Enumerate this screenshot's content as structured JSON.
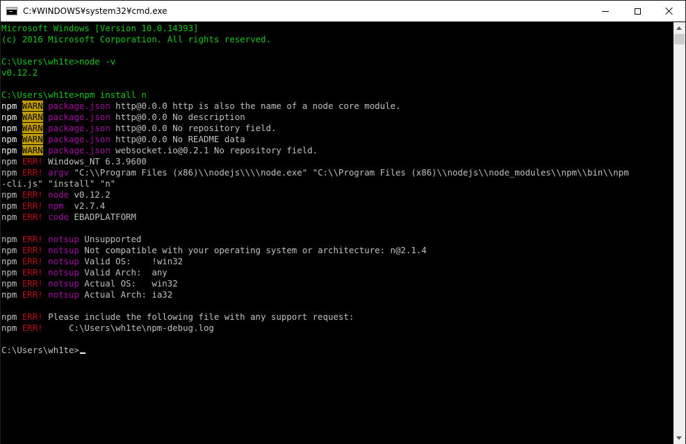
{
  "window": {
    "title": "C:¥WINDOWS¥system32¥cmd.exe",
    "controls": [
      "minimize",
      "maximize",
      "close"
    ]
  },
  "colors": {
    "console_bg": "#000000",
    "green": "#13C713",
    "white": "#F2F2F2",
    "gray": "#C0C0C0",
    "magenta": "#A10EA1",
    "red": "#B40F0F",
    "warn_highlight": "#C19C00"
  },
  "terminal": {
    "lines": [
      [
        {
          "t": "Microsoft Windows [Version 10.0.14393]",
          "c": "green"
        }
      ],
      [
        {
          "t": "(c) 2016 Microsoft Corporation. All rights reserved.",
          "c": "green"
        }
      ],
      [],
      [
        {
          "t": "C:\\Users\\wh1te>node -v",
          "c": "green"
        }
      ],
      [
        {
          "t": "v0.12.2",
          "c": "green"
        }
      ],
      [],
      [
        {
          "t": "C:\\Users\\wh1te>npm install n",
          "c": "green"
        }
      ],
      [
        {
          "t": "npm",
          "c": "white"
        },
        {
          "t": " "
        },
        {
          "t": "WARN",
          "c": "warn-bg"
        },
        {
          "t": " "
        },
        {
          "t": "package.json",
          "c": "magenta"
        },
        {
          "t": " http@0.0.0 http is also the name of a node core module."
        }
      ],
      [
        {
          "t": "npm",
          "c": "white"
        },
        {
          "t": " "
        },
        {
          "t": "WARN",
          "c": "warn-bg"
        },
        {
          "t": " "
        },
        {
          "t": "package.json",
          "c": "magenta"
        },
        {
          "t": " http@0.0.0 No description"
        }
      ],
      [
        {
          "t": "npm",
          "c": "white"
        },
        {
          "t": " "
        },
        {
          "t": "WARN",
          "c": "warn-bg"
        },
        {
          "t": " "
        },
        {
          "t": "package.json",
          "c": "magenta"
        },
        {
          "t": " http@0.0.0 No repository field."
        }
      ],
      [
        {
          "t": "npm",
          "c": "white"
        },
        {
          "t": " "
        },
        {
          "t": "WARN",
          "c": "warn-bg"
        },
        {
          "t": " "
        },
        {
          "t": "package.json",
          "c": "magenta"
        },
        {
          "t": " http@0.0.0 No README data"
        }
      ],
      [
        {
          "t": "npm",
          "c": "white"
        },
        {
          "t": " "
        },
        {
          "t": "WARN",
          "c": "warn-bg"
        },
        {
          "t": " "
        },
        {
          "t": "package.json",
          "c": "magenta"
        },
        {
          "t": " websocket.io@0.2.1 No repository field."
        }
      ],
      [
        {
          "t": "npm "
        },
        {
          "t": "ERR!",
          "c": "red"
        },
        {
          "t": " Windows_NT 6.3.9600"
        }
      ],
      [
        {
          "t": "npm "
        },
        {
          "t": "ERR!",
          "c": "red"
        },
        {
          "t": " "
        },
        {
          "t": "argv",
          "c": "magenta"
        },
        {
          "t": " \"C:\\\\Program Files (x86)\\\\nodejs\\\\\\\\node.exe\" \"C:\\\\Program Files (x86)\\\\nodejs\\\\node_modules\\\\npm\\\\bin\\\\npm"
        }
      ],
      [
        {
          "t": "-cli.js\" \"install\" \"n\""
        }
      ],
      [
        {
          "t": "npm "
        },
        {
          "t": "ERR!",
          "c": "red"
        },
        {
          "t": " "
        },
        {
          "t": "node",
          "c": "magenta"
        },
        {
          "t": " v0.12.2"
        }
      ],
      [
        {
          "t": "npm "
        },
        {
          "t": "ERR!",
          "c": "red"
        },
        {
          "t": " "
        },
        {
          "t": "npm",
          "c": "magenta"
        },
        {
          "t": "  v2.7.4"
        }
      ],
      [
        {
          "t": "npm "
        },
        {
          "t": "ERR!",
          "c": "red"
        },
        {
          "t": " "
        },
        {
          "t": "code",
          "c": "magenta"
        },
        {
          "t": " EBADPLATFORM"
        }
      ],
      [],
      [
        {
          "t": "npm "
        },
        {
          "t": "ERR!",
          "c": "red"
        },
        {
          "t": " "
        },
        {
          "t": "notsup",
          "c": "magenta"
        },
        {
          "t": " Unsupported"
        }
      ],
      [
        {
          "t": "npm "
        },
        {
          "t": "ERR!",
          "c": "red"
        },
        {
          "t": " "
        },
        {
          "t": "notsup",
          "c": "magenta"
        },
        {
          "t": " Not compatible with your operating system or architecture: n@2.1.4"
        }
      ],
      [
        {
          "t": "npm "
        },
        {
          "t": "ERR!",
          "c": "red"
        },
        {
          "t": " "
        },
        {
          "t": "notsup",
          "c": "magenta"
        },
        {
          "t": " Valid OS:    !win32"
        }
      ],
      [
        {
          "t": "npm "
        },
        {
          "t": "ERR!",
          "c": "red"
        },
        {
          "t": " "
        },
        {
          "t": "notsup",
          "c": "magenta"
        },
        {
          "t": " Valid Arch:  any"
        }
      ],
      [
        {
          "t": "npm "
        },
        {
          "t": "ERR!",
          "c": "red"
        },
        {
          "t": " "
        },
        {
          "t": "notsup",
          "c": "magenta"
        },
        {
          "t": " Actual OS:   win32"
        }
      ],
      [
        {
          "t": "npm "
        },
        {
          "t": "ERR!",
          "c": "red"
        },
        {
          "t": " "
        },
        {
          "t": "notsup",
          "c": "magenta"
        },
        {
          "t": " Actual Arch: ia32"
        }
      ],
      [],
      [
        {
          "t": "npm "
        },
        {
          "t": "ERR!",
          "c": "red"
        },
        {
          "t": " Please include the following file with any support request:"
        }
      ],
      [
        {
          "t": "npm "
        },
        {
          "t": "ERR!",
          "c": "red"
        },
        {
          "t": "     C:\\Users\\wh1te\\npm-debug.log"
        }
      ],
      [],
      [
        {
          "t": "C:\\Users\\wh1te>"
        },
        {
          "cursor": true
        }
      ]
    ]
  }
}
